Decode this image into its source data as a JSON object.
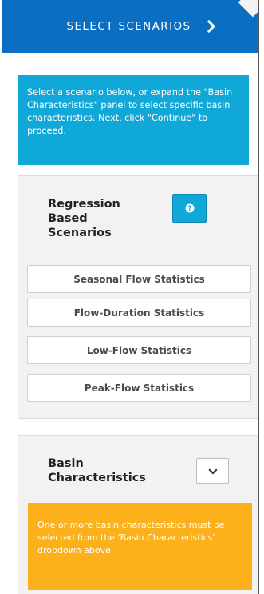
{
  "header": {
    "title": "SELECT SCENARIOS",
    "chevron_icon": "chevron-right-icon",
    "background": "#0a6fc2"
  },
  "info_box": {
    "text": "Select a scenario below, or expand the \"Basin Characteristics\" panel to select specific basin characteristics. Next, click \"Continue\" to proceed.",
    "background": "#10a8d8"
  },
  "regression_panel": {
    "title": "Regression Based Scenarios",
    "help_icon": "question-circle-icon",
    "buttons": [
      {
        "label": "Seasonal Flow Statistics"
      },
      {
        "label": "Flow-Duration Statistics"
      },
      {
        "label": "Low-Flow Statistics"
      },
      {
        "label": "Peak-Flow Statistics"
      }
    ]
  },
  "basin_panel": {
    "title": "Basin Characteristics",
    "dropdown_icon": "chevron-down-icon",
    "warning": {
      "text": "One or more basin characteristics must be selected from the 'Basin Characteristics' dropdown above",
      "background": "#fbb01c"
    }
  }
}
